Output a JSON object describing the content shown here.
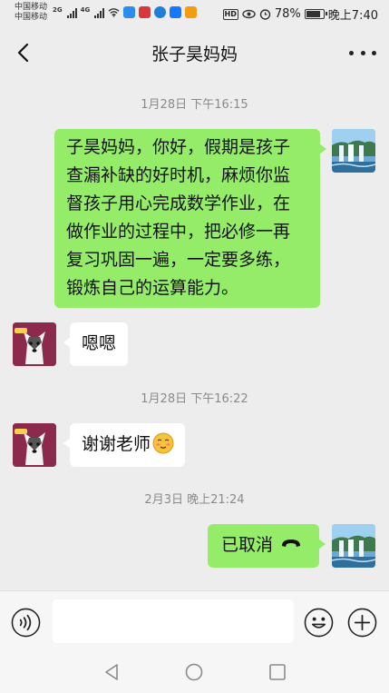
{
  "status_bar": {
    "carrier_1": "中国移动",
    "carrier_2": "中国移动",
    "net_1": "2G",
    "net_2": "4G",
    "battery_percent": "78%",
    "battery_level": 0.78,
    "time": "晚上7:40",
    "hd_label": "HD",
    "app_icons": [
      "message-app-icon",
      "mail-app-icon",
      "browser-app-icon",
      "alipay-app-icon",
      "video-app-icon"
    ]
  },
  "header": {
    "title": "张子昊妈妈"
  },
  "messages": {
    "ts1": "1月28日 下午16:15",
    "m1_lines": [
      "子昊妈妈，你好，假期是孩子",
      "查漏补缺的好时机，麻烦你监",
      "督孩子用心完成数学作业，在",
      "做作业的过程中，把必修一再",
      "复习巩固一遍，一定要多练，",
      "锻炼自己的运算能力。"
    ],
    "m2": "嗯嗯",
    "ts2": "1月28日 下午16:22",
    "m3": "谢谢老师",
    "m3_emoji": "smiling-blush-emoji",
    "ts3": "2月3日 晚上21:24",
    "m4": "已取消",
    "m4_icon": "phone-hangup-icon"
  },
  "input": {
    "value": "",
    "placeholder": ""
  },
  "colors": {
    "my_bubble": "#95ec69",
    "their_bubble": "#ffffff",
    "background": "#ededed"
  }
}
